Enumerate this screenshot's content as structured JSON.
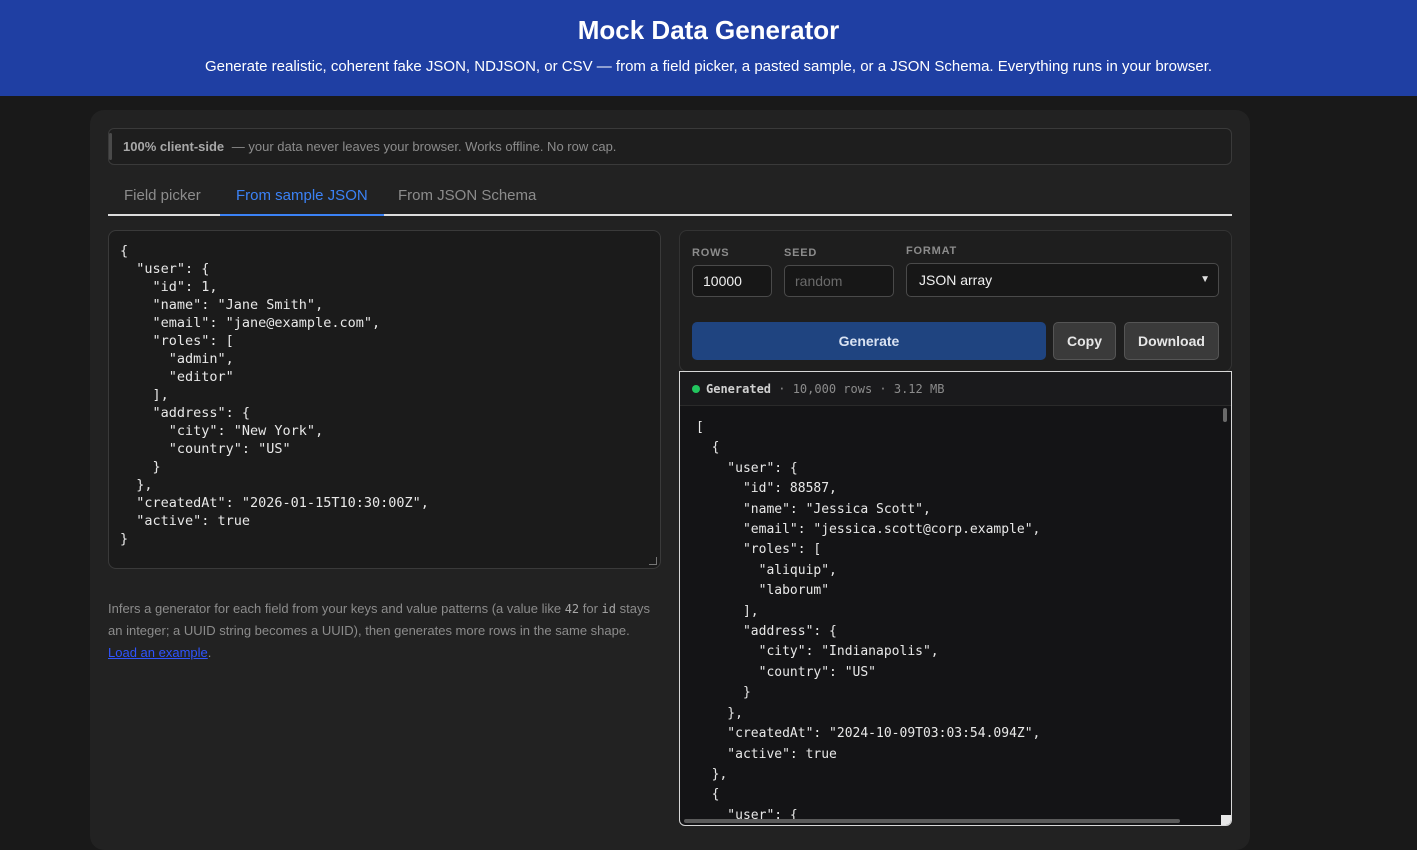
{
  "header": {
    "title": "Mock Data Generator",
    "subtitle": "Generate realistic, coherent fake JSON, NDJSON, or CSV — from a field picker, a pasted sample, or a JSON Schema. Everything runs in your browser."
  },
  "notice": {
    "strong": "100% client-side",
    "text": "— your data never leaves your browser. Works offline. No row cap."
  },
  "tabs": [
    {
      "label": "Field picker",
      "active": false
    },
    {
      "label": "From sample JSON",
      "active": true
    },
    {
      "label": "From JSON Schema",
      "active": false
    }
  ],
  "sample_json": "{\n  \"user\": {\n    \"id\": 1,\n    \"name\": \"Jane Smith\",\n    \"email\": \"jane@example.com\",\n    \"roles\": [\n      \"admin\",\n      \"editor\"\n    ],\n    \"address\": {\n      \"city\": \"New York\",\n      \"country\": \"US\"\n    }\n  },\n  \"createdAt\": \"2026-01-15T10:30:00Z\",\n  \"active\": true\n}",
  "help": {
    "part1": "Infers a generator for each field from your keys and value patterns (a value like ",
    "code1": "42",
    "part2": " for ",
    "code2": "id",
    "part3": " stays an integer; a UUID string becomes a UUID), then generates more rows in the same shape. ",
    "link": "Load an example",
    "part4": "."
  },
  "controls": {
    "rows_label": "ROWS",
    "rows_value": "10000",
    "seed_label": "SEED",
    "seed_placeholder": "random",
    "format_label": "FORMAT",
    "format_value": "JSON array",
    "generate_label": "Generate",
    "copy_label": "Copy",
    "download_label": "Download"
  },
  "output": {
    "status_word": "Generated",
    "status_meta": " · 10,000 rows · 3.12 MB",
    "code": "[\n  {\n    \"user\": {\n      \"id\": 88587,\n      \"name\": \"Jessica Scott\",\n      \"email\": \"jessica.scott@corp.example\",\n      \"roles\": [\n        \"aliquip\",\n        \"laborum\"\n      ],\n      \"address\": {\n        \"city\": \"Indianapolis\",\n        \"country\": \"US\"\n      }\n    },\n    \"createdAt\": \"2024-10-09T03:03:54.094Z\",\n    \"active\": true\n  },\n  {\n    \"user\": {",
    "status_color": "#22c55e"
  },
  "colors": {
    "header_bg": "#1f3fa3",
    "accent": "#3b82f6",
    "link": "#2f54ff"
  }
}
